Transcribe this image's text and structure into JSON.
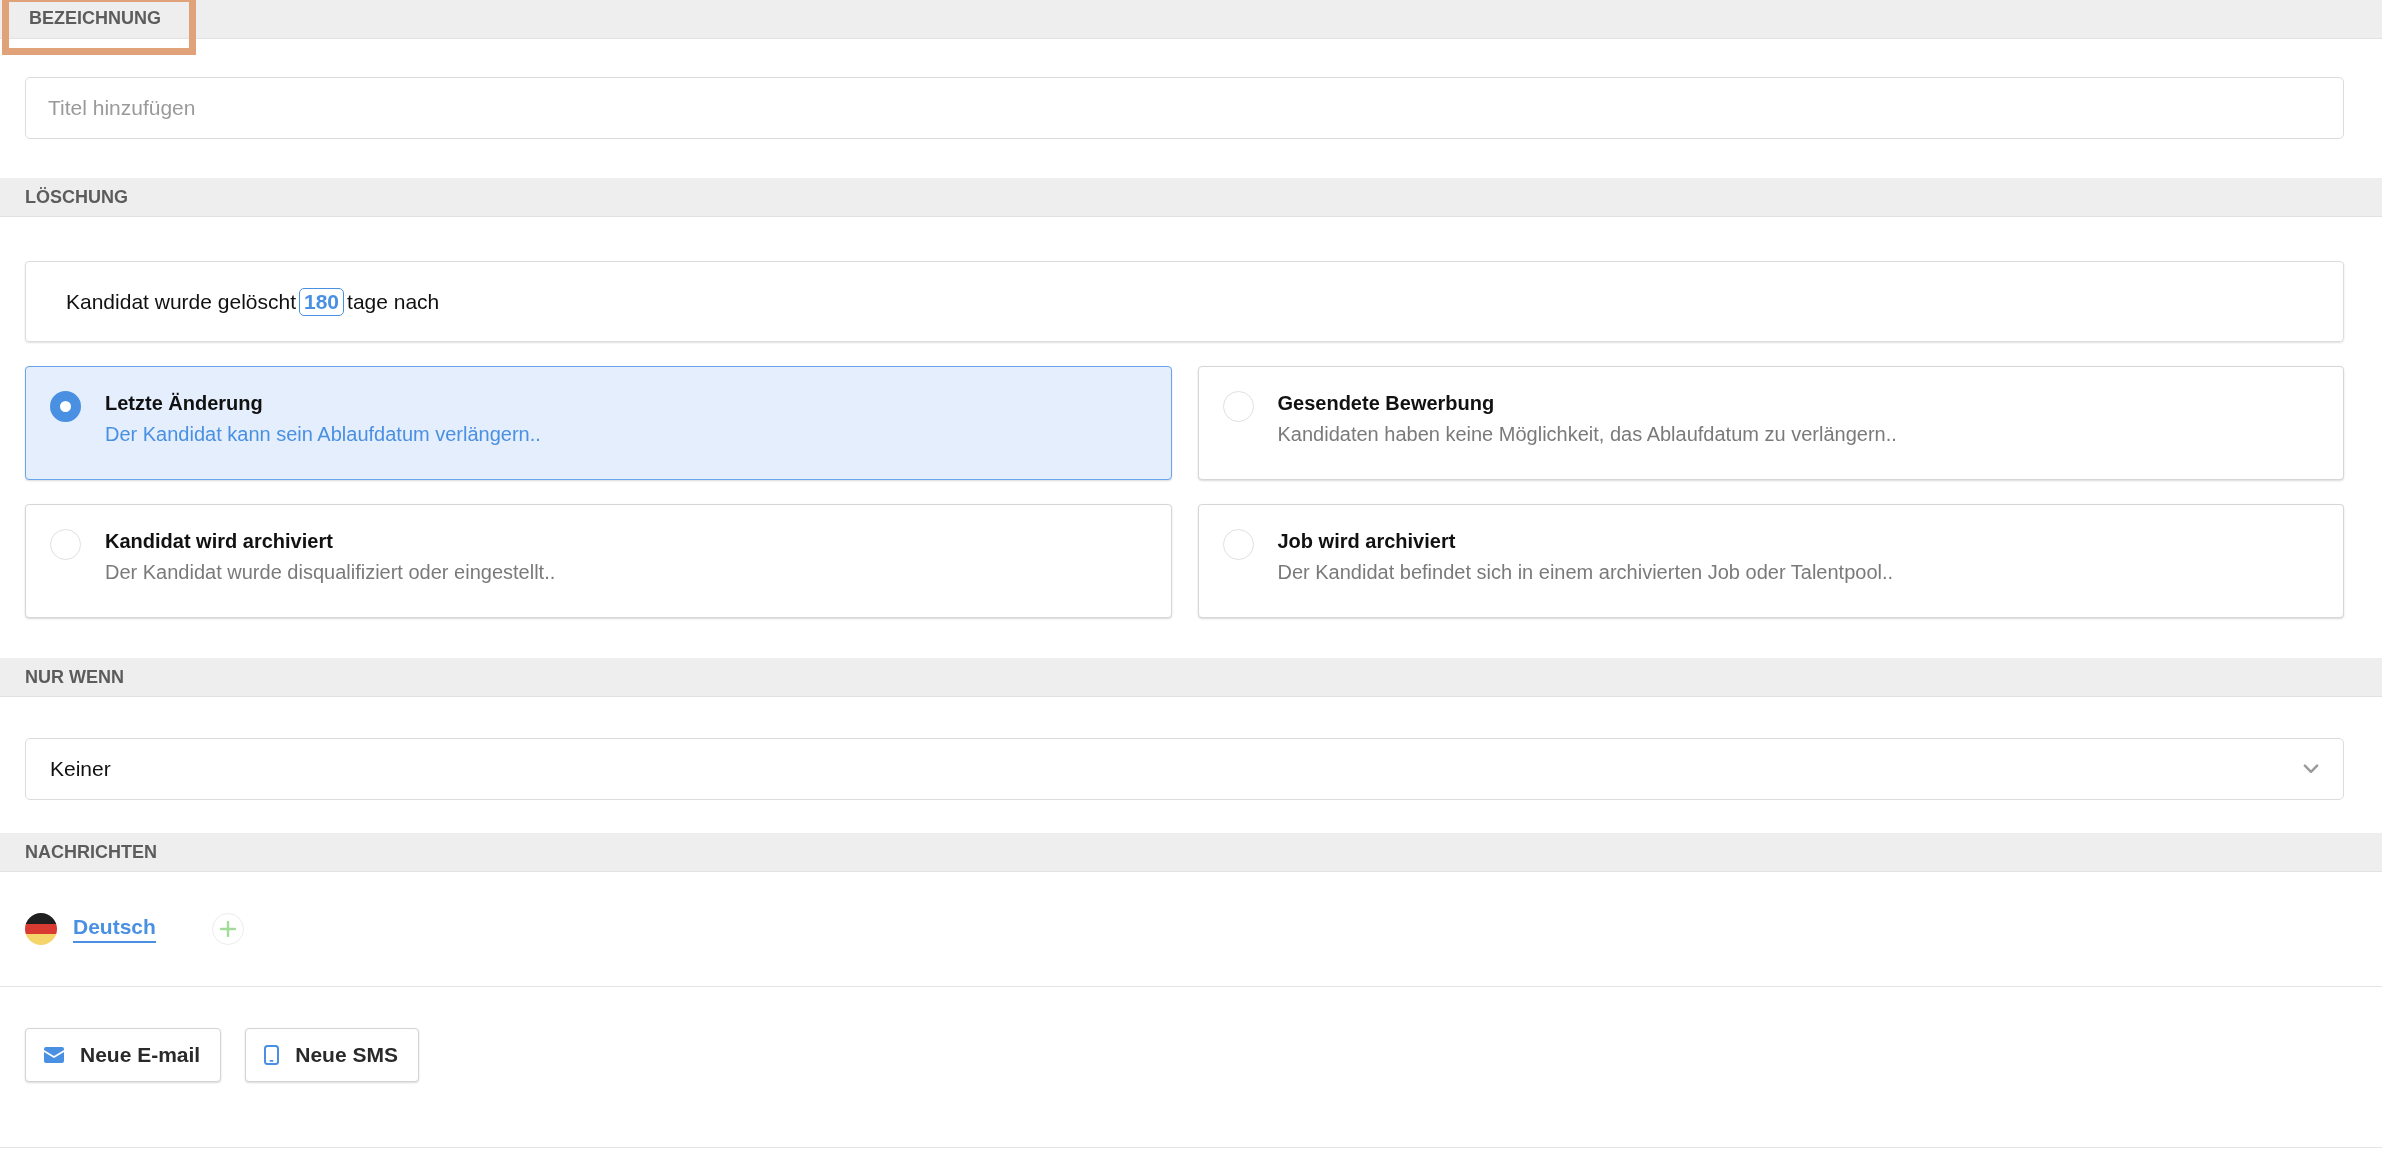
{
  "sections": [
    {
      "kind": "title",
      "header": "BEZEICHNUNG",
      "highlighted": true,
      "title_field": {
        "placeholder": "Titel hinzufügen"
      }
    },
    {
      "kind": "deletion",
      "header": "LÖSCHUNG",
      "highlighted": false,
      "rule": {
        "prefix": "Kandidat wurde gelöscht",
        "days": "180",
        "suffix": "tage nach"
      },
      "options": [
        {
          "title": "Letzte Änderung",
          "description": "Der Kandidat kann sein Ablaufdatum verlängern..",
          "selected": true
        },
        {
          "title": "Gesendete Bewerbung",
          "description": "Kandidaten haben keine Möglichkeit, das Ablaufdatum zu verlängern..",
          "selected": false
        },
        {
          "title": "Kandidat wird archiviert",
          "description": "Der Kandidat wurde disqualifiziert oder eingestellt..",
          "selected": false
        },
        {
          "title": "Job wird archiviert",
          "description": "Der Kandidat befindet sich in einem archivierten Job oder Talentpool..",
          "selected": false
        }
      ]
    },
    {
      "kind": "condition",
      "header": "NUR WENN",
      "highlighted": false,
      "dropdown": {
        "value": "Keiner"
      }
    },
    {
      "kind": "messages",
      "header": "NACHRICHTEN",
      "highlighted": false,
      "languages": [
        {
          "label": "Deutsch",
          "selected": true
        }
      ],
      "buttons": [
        {
          "kind": "email",
          "label": "Neue E-mail"
        },
        {
          "kind": "sms",
          "label": "Neue SMS"
        }
      ]
    }
  ]
}
